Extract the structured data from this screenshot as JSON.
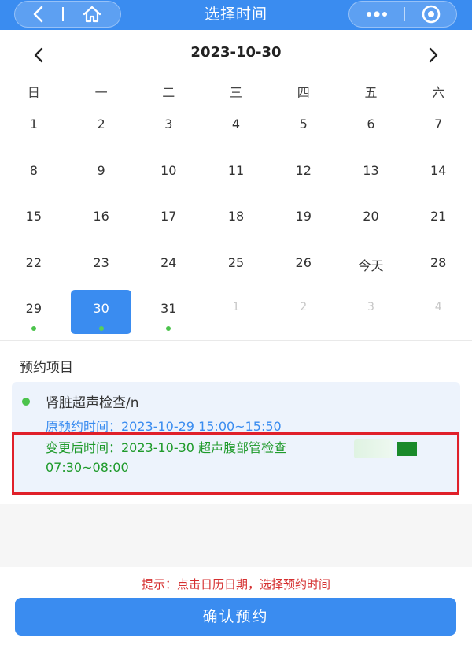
{
  "colors": {
    "brand": "#3a8cf0",
    "accent_green": "#4cc34c",
    "alert_red": "#e0202a",
    "tip_red": "#d53030"
  },
  "topbar": {
    "title": "选择时间",
    "icons": [
      "back-icon",
      "home-icon",
      "more-icon",
      "target-icon"
    ]
  },
  "calendar": {
    "month_label": "2023-10-30",
    "weekdays": [
      "日",
      "一",
      "二",
      "三",
      "四",
      "五",
      "六"
    ],
    "weeks": [
      [
        "1",
        "2",
        "3",
        "4",
        "5",
        "6",
        "7"
      ],
      [
        "8",
        "9",
        "10",
        "11",
        "12",
        "13",
        "14"
      ],
      [
        "15",
        "16",
        "17",
        "18",
        "19",
        "20",
        "21"
      ],
      [
        "22",
        "23",
        "24",
        "25",
        "26",
        "今天",
        "28"
      ],
      [
        "29",
        "30",
        "31",
        "1",
        "2",
        "3",
        "4"
      ]
    ],
    "selected_day": "30",
    "days_with_dot": [
      "29",
      "30",
      "31"
    ]
  },
  "appointment": {
    "section_title": "预约项目",
    "item_name": "肾脏超声检查/n",
    "original_time": "原预约时间：2023-10-29 15:00~15:50",
    "new_time": "变更后时间：2023-10-30 超声腹部管检查 07:30~08:00"
  },
  "footer": {
    "tip": "提示：点击日历日期，选择预约时间",
    "confirm_label": "确认预约"
  }
}
